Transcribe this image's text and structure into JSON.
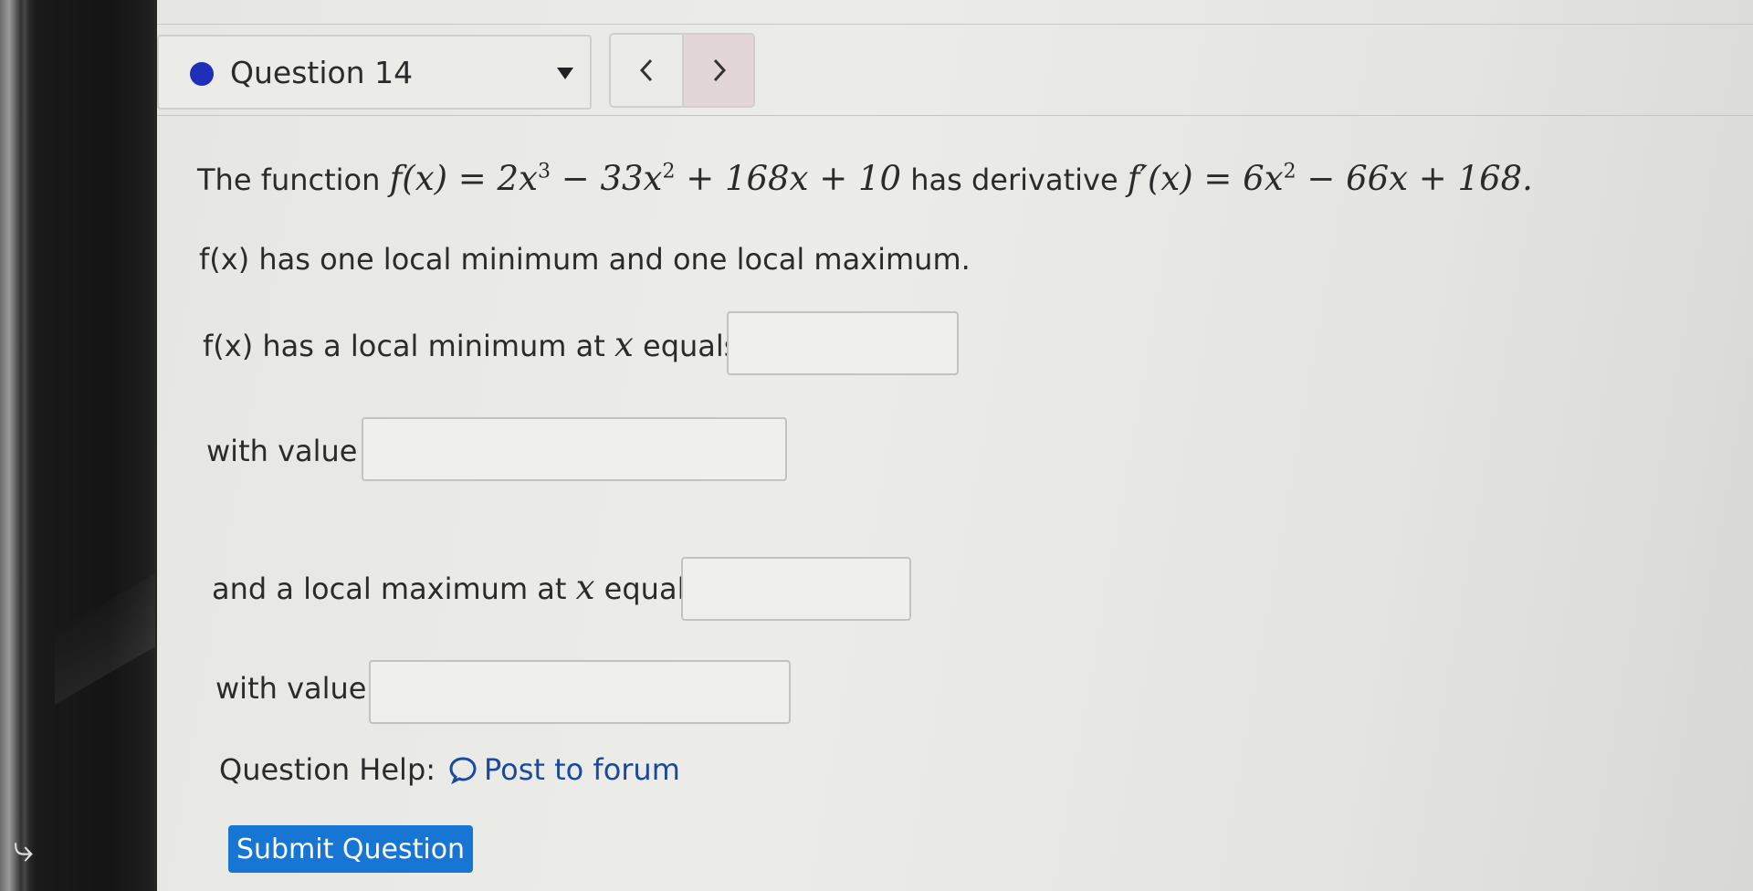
{
  "header": {
    "question_label": "Question 14",
    "prev_symbol": "<",
    "next_symbol": ">"
  },
  "problem": {
    "intro_text": "The function",
    "function_def": "f(x) = 2x",
    "function_exp1": "3",
    "function_mid": " − 33x",
    "function_exp2": "2",
    "function_tail": " + 168x + 10",
    "connector_text": "has derivative",
    "derivative_def": "f′(x) = 6x",
    "derivative_exp": "2",
    "derivative_tail": " − 66x + 168.",
    "statement": "f(x) has one local minimum and one local maximum.",
    "min_x_prefix": "f(x) has a local minimum at",
    "min_x_var": "x",
    "min_x_suffix": "equals",
    "min_value_label": "with value",
    "max_x_prefix": "and a local maximum at",
    "max_x_var": "x",
    "max_x_suffix": "equals",
    "max_value_label": "with value"
  },
  "answers": {
    "min_x": "",
    "min_value": "",
    "max_x": "",
    "max_value": ""
  },
  "help": {
    "label": "Question Help:",
    "forum_link": "Post to forum"
  },
  "submit_label": "Submit Question",
  "colors": {
    "status_dot": "#1f2fb8",
    "submit_bg": "#1776d4",
    "link": "#1a4aa0"
  }
}
